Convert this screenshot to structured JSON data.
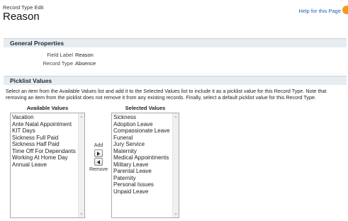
{
  "header": {
    "breadcrumb": "Record Type Edit",
    "title": "Reason",
    "help_link": "Help for this Page"
  },
  "general_properties": {
    "title": "General Properties",
    "fields": [
      {
        "label": "Field Label",
        "value": "Reason"
      },
      {
        "label": "Record Type",
        "value": "Absence"
      }
    ]
  },
  "picklist_values": {
    "title": "Picklist Values",
    "instructions": "Select an item from the Available Values list and add it to the Selected Values list to include it as a picklist value for this Record Type. Note that removing an item from the picklist does not remove it from any existing records. Finally, select a default picklist value for this Record Type.",
    "available_header": "Available Values",
    "selected_header": "Selected Values",
    "available": [
      "Vacation",
      "Ante Natal Appointment",
      "KIT Days",
      "Sickness Full Paid",
      "Sickness Half Paid",
      "Time Off For Dependants",
      "Working At Home Day",
      "Annual Leave"
    ],
    "selected": [
      "Sickness",
      "Adoption Leave",
      "Compassionate Leave",
      "Funeral",
      "Jury Service",
      "Maternity",
      "Medical Appointments",
      "Military Leave",
      "Parental Leave",
      "Paternity",
      "Personal Issues",
      "Unpaid Leave"
    ],
    "add_label": "Add",
    "remove_label": "Remove"
  },
  "icons": {
    "help": "help-icon",
    "add": "arrow-right-icon",
    "remove": "arrow-left-icon"
  },
  "colors": {
    "section_bar": "#e7ecf0",
    "link": "#1f5fb5",
    "help_icon": "#f59a1e"
  }
}
